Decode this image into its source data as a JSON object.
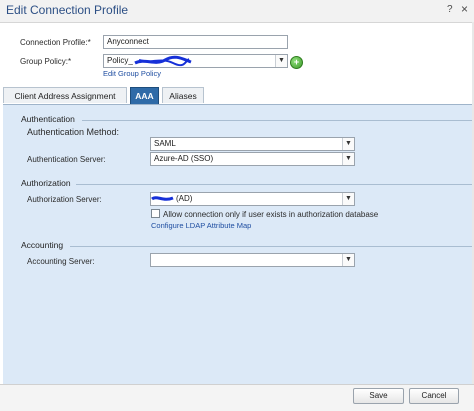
{
  "window": {
    "title": "Edit Connection Profile",
    "help_glyph": "?",
    "close_glyph": "×"
  },
  "form": {
    "connection_profile": {
      "label": "Connection Profile:*",
      "value": "Anyconnect"
    },
    "group_policy": {
      "label": "Group Policy:*",
      "value": "Policy_",
      "edit_link": "Edit Group Policy"
    }
  },
  "tabs": [
    {
      "label": "Client Address Assignment",
      "active": false
    },
    {
      "label": "AAA",
      "active": true
    },
    {
      "label": "Aliases",
      "active": false
    }
  ],
  "aaa": {
    "authentication": {
      "title": "Authentication",
      "method_label": "Authentication Method:",
      "method_value": "SAML",
      "server_label": "Authentication Server:",
      "server_value": "Azure-AD (SSO)"
    },
    "authorization": {
      "title": "Authorization",
      "server_label": "Authorization Server:",
      "server_value": "(AD)",
      "checkbox_label": "Allow connection only if user exists in authorization database",
      "checkbox_checked": false,
      "ldap_link": "Configure LDAP Attribute Map"
    },
    "accounting": {
      "title": "Accounting",
      "server_label": "Accounting Server:",
      "server_value": ""
    }
  },
  "footer": {
    "save_label": "Save",
    "cancel_label": "Cancel"
  },
  "colors": {
    "title_text": "#2c4f85",
    "tab_active": "#2f6ba8",
    "panel_bg": "#dce9f7",
    "link": "#1f4ea1",
    "add_icon": "#3d9a2a"
  },
  "icons": {
    "add": "plus-circle-icon",
    "dropdown": "chevron-down-icon",
    "help": "help-icon",
    "close": "close-icon"
  }
}
